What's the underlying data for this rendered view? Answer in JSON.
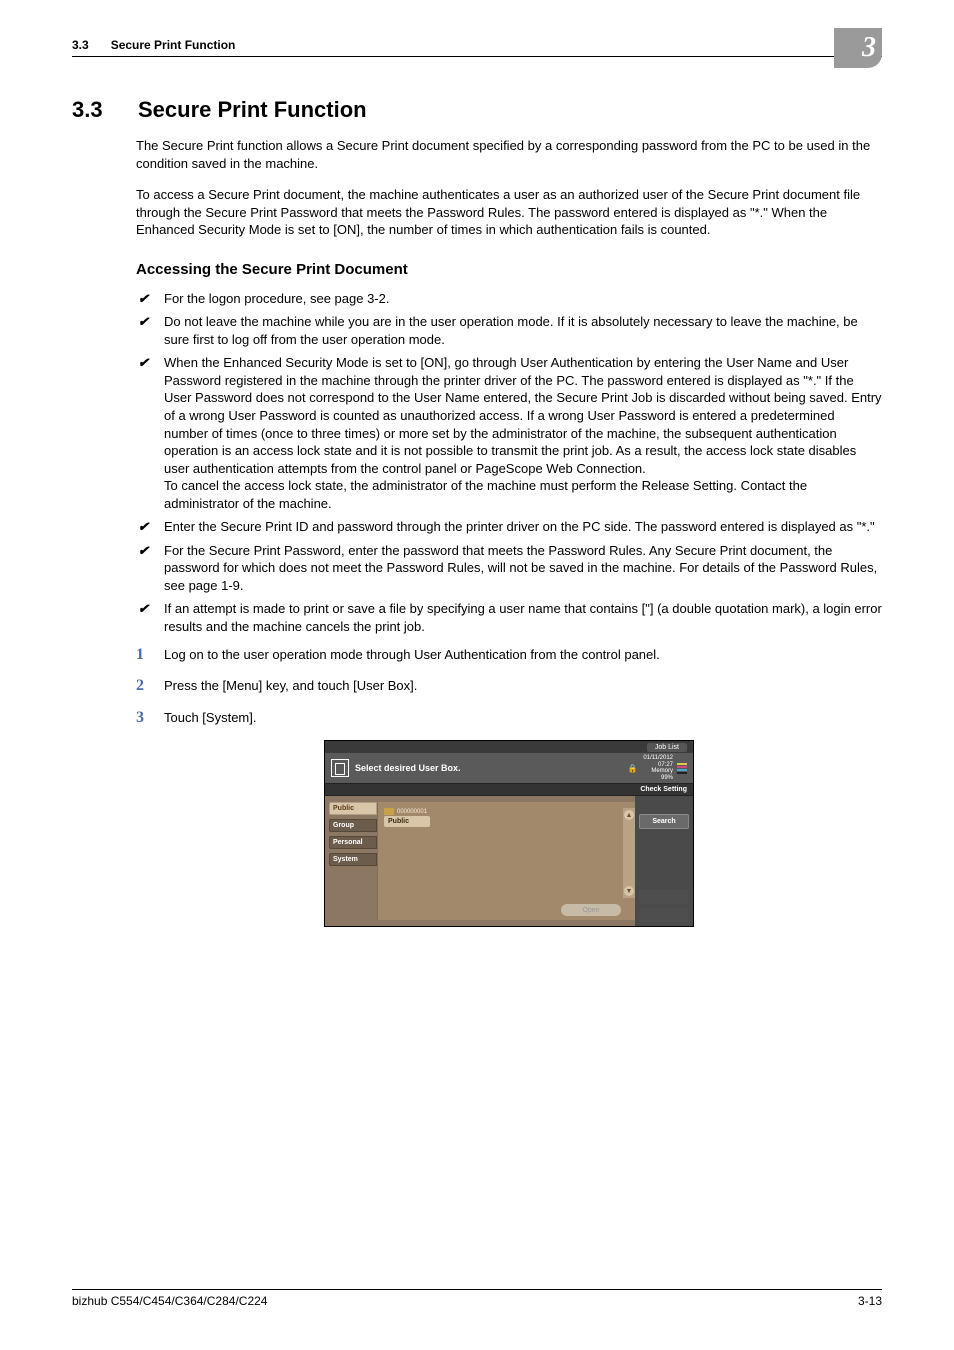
{
  "running_header": {
    "section_number": "3.3",
    "section_title": "Secure Print Function"
  },
  "chapter_badge": "3",
  "section": {
    "number": "3.3",
    "title": "Secure Print Function"
  },
  "intro_paragraphs": [
    "The Secure Print function allows a Secure Print document specified by a corresponding password from the PC to be used in the condition saved in the machine.",
    "To access a Secure Print document, the machine authenticates a user as an authorized user of the Secure Print document file through the Secure Print Password that meets the Password Rules. The password entered is displayed as \"*.\" When the Enhanced Security Mode is set to [ON], the number of times in which authentication fails is counted."
  ],
  "subsection_title": "Accessing the Secure Print Document",
  "checklist": [
    "For the logon procedure, see page 3-2.",
    "Do not leave the machine while you are in the user operation mode. If it is absolutely necessary to leave the machine, be sure first to log off from the user operation mode.",
    "When the Enhanced Security Mode is set to [ON], go through User Authentication by entering the User Name and User Password registered in the machine through the printer driver of the PC. The password entered is displayed as \"*.\" If the User Password does not correspond to the User Name entered, the Secure Print Job is discarded without being saved. Entry of a wrong User Password is counted as unauthorized access. If a wrong User Password is entered a predetermined number of times (once to three times) or more set by the administrator of the machine, the subsequent authentication operation is an access lock state and it is not possible to transmit the print job. As a result, the access lock state disables user authentication attempts from the control panel or PageScope Web Connection.\nTo cancel the access lock state, the administrator of the machine must perform the Release Setting. Contact the administrator of the machine.",
    "Enter the Secure Print ID and password through the printer driver on the PC side. The password entered is displayed as \"*.\"",
    "For the Secure Print Password, enter the password that meets the Password Rules. Any Secure Print document, the password for which does not meet the Password Rules, will not be saved in the machine. For details of the Password Rules, see page 1-9.",
    "If an attempt is made to print or save a file by specifying a user name that contains [\"] (a double quotation mark), a login error results and the machine cancels the print job."
  ],
  "steps": [
    "Log on to the user operation mode through User Authentication from the control panel.",
    "Press the [Menu] key, and touch [User Box].",
    "Touch [System]."
  ],
  "screen": {
    "job_list": "Job List",
    "header_title": "Select desired User Box.",
    "status": {
      "date": "01/11/2012",
      "time": "07:27",
      "memory": "Memory",
      "percent": "99%"
    },
    "toner": {
      "y": "Y",
      "m": "M",
      "c": "C",
      "k": "K"
    },
    "check_setting": "Check Setting",
    "tabs": [
      "Public",
      "Group",
      "Personal",
      "System"
    ],
    "active_tab_index": 0,
    "box": {
      "number": "000000001",
      "label": "Public"
    },
    "open": "Open",
    "right_buttons": [
      "Search"
    ]
  },
  "footer": {
    "left": "bizhub C554/C454/C364/C284/C224",
    "right": "3-13"
  }
}
